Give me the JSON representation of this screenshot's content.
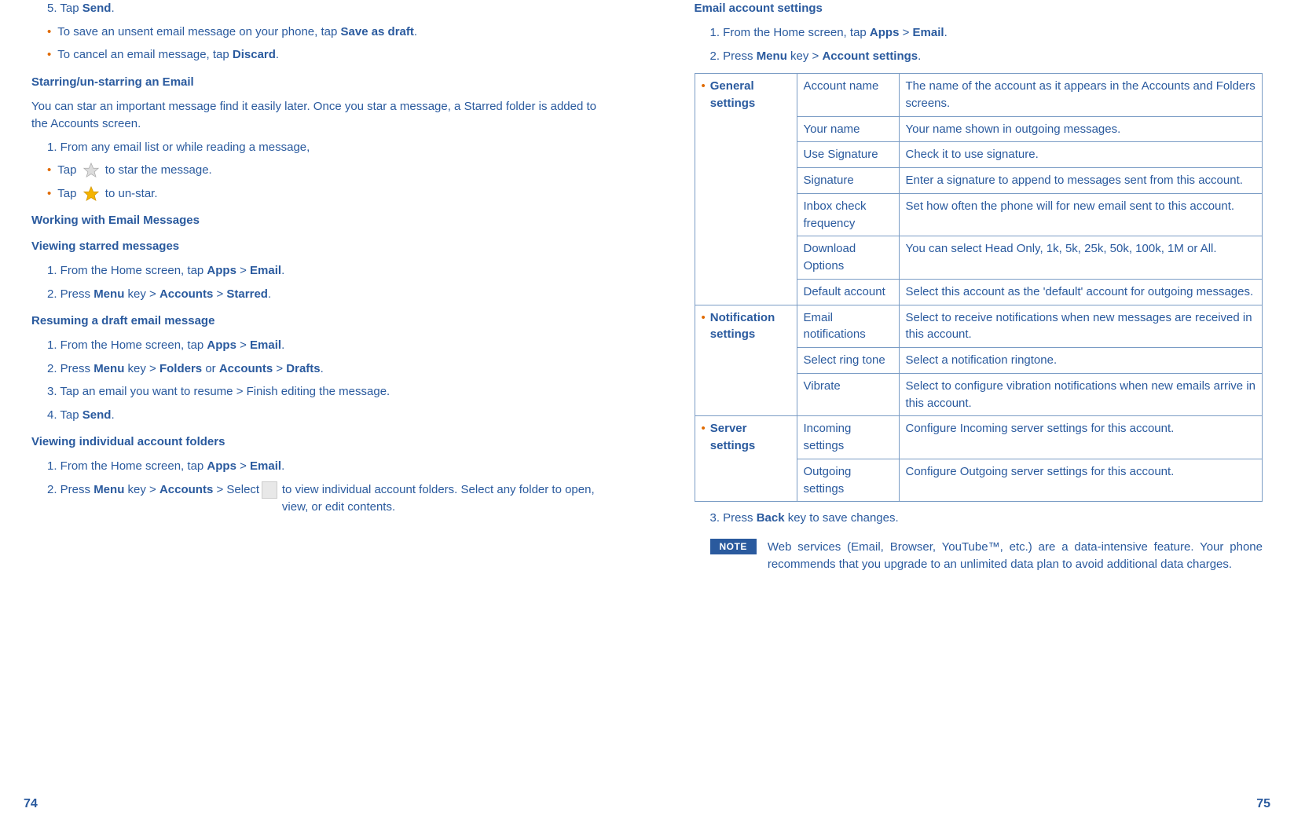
{
  "left": {
    "step5_pre": "5. Tap ",
    "step5_bold": "Send",
    "step5_post": ".",
    "bullet_save_pre": "To save an unsent email message on your phone, tap ",
    "bullet_save_bold": "Save as draft",
    "bullet_save_post": ".",
    "bullet_cancel_pre": "To cancel an email message, tap ",
    "bullet_cancel_bold": "Discard",
    "bullet_cancel_post": ".",
    "starring_heading": "Starring/un-starring an Email",
    "starring_desc": "You can star an important message find it easily later. Once you star a message, a Starred folder is added to the Accounts screen.",
    "starring_step1": "1. From any email list or while reading a message,",
    "star_bullet_pre": "Tap ",
    "star_bullet_post": " to star the message.",
    "unstar_bullet_pre": "Tap ",
    "unstar_bullet_post": " to un-star.",
    "working_heading": "Working with Email Messages",
    "viewing_starred_heading": "Viewing starred messages",
    "vs_step1_pre": "1. From the Home screen, tap ",
    "vs_step1_b1": "Apps",
    "vs_step1_mid": " > ",
    "vs_step1_b2": "Email",
    "vs_step1_post": ".",
    "vs_step2_pre": "2. Press ",
    "vs_step2_b1": "Menu",
    "vs_step2_mid1": " key > ",
    "vs_step2_b2": "Accounts",
    "vs_step2_mid2": " > ",
    "vs_step2_b3": "Starred",
    "vs_step2_post": ".",
    "resuming_heading": "Resuming a draft email message",
    "rd_step1_pre": "1. From the Home screen, tap ",
    "rd_step1_b1": "Apps",
    "rd_step1_mid": " > ",
    "rd_step1_b2": "Email",
    "rd_step1_post": ".",
    "rd_step2_pre": "2. Press ",
    "rd_step2_b1": "Menu",
    "rd_step2_mid1": " key > ",
    "rd_step2_b2": "Folders",
    "rd_step2_mid2": " or ",
    "rd_step2_b3": "Accounts",
    "rd_step2_mid3": " > ",
    "rd_step2_b4": "Drafts",
    "rd_step2_post": ".",
    "rd_step3": "3. Tap an email you want to resume > Finish editing the message.",
    "rd_step4_pre": "4. Tap ",
    "rd_step4_b1": "Send",
    "rd_step4_post": ".",
    "vif_heading": "Viewing individual account folders",
    "vif_step1_pre": "1. From the Home screen, tap ",
    "vif_step1_b1": "Apps",
    "vif_step1_mid": " > ",
    "vif_step1_b2": "Email",
    "vif_step1_post": ".",
    "vif_step2_pre": "2. Press ",
    "vif_step2_b1": "Menu",
    "vif_step2_mid1": " key > ",
    "vif_step2_b2": "Accounts",
    "vif_step2_mid2": " > Select ",
    "vif_step2_post": " to view individual account folders. Select any folder to open, view, or edit contents.",
    "page_num": "74"
  },
  "right": {
    "eas_heading": "Email account settings",
    "eas_step1_pre": "1. From the Home screen, tap ",
    "eas_step1_b1": "Apps",
    "eas_step1_mid": " > ",
    "eas_step1_b2": "Email",
    "eas_step1_post": ".",
    "eas_step2_pre": "2. Press ",
    "eas_step2_b1": "Menu",
    "eas_step2_mid1": " key > ",
    "eas_step2_b2": "Account settings",
    "eas_step2_post": ".",
    "table": {
      "general": {
        "label": "General settings",
        "rows": [
          {
            "opt": "Account name",
            "desc": "The name of the account as it appears in the Accounts and Folders screens."
          },
          {
            "opt": "Your name",
            "desc": "Your name shown in outgoing messages."
          },
          {
            "opt": "Use Signature",
            "desc": "Check it to use signature."
          },
          {
            "opt": "Signature",
            "desc": "Enter a signature to append to messages sent from this account."
          },
          {
            "opt": "Inbox check frequency",
            "desc": "Set how often the phone will for new email sent to this account."
          },
          {
            "opt": "Download Options",
            "desc": "You can select Head Only, 1k, 5k, 25k, 50k, 100k, 1M or All."
          },
          {
            "opt": "Default account",
            "desc": "Select this account as the 'default' account for outgoing messages."
          }
        ]
      },
      "notification": {
        "label": "Notification settings",
        "rows": [
          {
            "opt": "Email notifications",
            "desc": "Select to receive notifications when new messages are received in this account."
          },
          {
            "opt": "Select ring tone",
            "desc": "Select a notification ringtone."
          },
          {
            "opt": "Vibrate",
            "desc": "Select to configure vibration notifications when new emails arrive in this account."
          }
        ]
      },
      "server": {
        "label": "Server settings",
        "rows": [
          {
            "opt": "Incoming settings",
            "desc": "Configure Incoming server settings for this account."
          },
          {
            "opt": "Outgoing settings",
            "desc": "Configure Outgoing server settings for this account."
          }
        ]
      }
    },
    "eas_step3_pre": "3. Press ",
    "eas_step3_b1": "Back",
    "eas_step3_post": " key to save changes.",
    "note_label": "NOTE",
    "note_text": "Web services (Email, Browser, YouTube™, etc.) are a data-intensive feature. Your phone recommends that you upgrade to an unlimited data plan to avoid additional data charges.",
    "page_num": "75"
  }
}
